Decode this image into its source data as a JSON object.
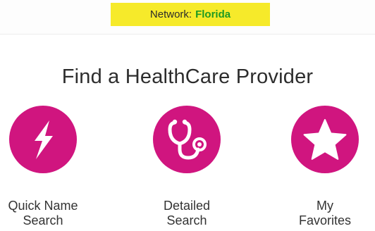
{
  "header": {
    "network_label": "Network:",
    "network_value": "Florida"
  },
  "main": {
    "title": "Find a HealthCare Provider",
    "options": [
      {
        "line1": "Quick Name",
        "line2": "Search",
        "icon": "lightning-bolt-icon"
      },
      {
        "line1": "Detailed",
        "line2": "Search",
        "icon": "stethoscope-icon"
      },
      {
        "line1": "My",
        "line2": "Favorites",
        "icon": "star-icon"
      }
    ]
  },
  "colors": {
    "accent": "#d0157f",
    "badge_bg": "#f6ea2a",
    "network_value": "#1e9a22"
  }
}
